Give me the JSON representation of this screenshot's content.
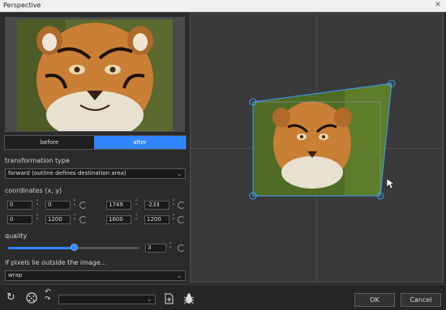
{
  "window": {
    "title": "Perspective",
    "close_glyph": "×"
  },
  "preview_toggle": {
    "before_label": "before",
    "after_label": "after",
    "selected": "after"
  },
  "transformation": {
    "label": "transformation type",
    "selected": "forward (outline defines destination area)"
  },
  "coordinates": {
    "label": "coordinates (x, y)",
    "rows": [
      [
        "0",
        "0",
        "1749",
        "-233"
      ],
      [
        "0",
        "1200",
        "1600",
        "1200"
      ]
    ]
  },
  "quality": {
    "label": "quality",
    "value": "3",
    "level_fraction": 0.5
  },
  "outside": {
    "label": "if pixels lie outside the image...",
    "selected": "wrap"
  },
  "buttons": {
    "ok_label": "OK",
    "cancel_label": "Cancel"
  },
  "icons": {
    "reset": "reset-icon",
    "random": "dice-icon",
    "undo_redo": "undo-redo-icon",
    "new_preset": "new-preset-icon",
    "bug": "bug-icon"
  },
  "colors": {
    "accent": "#2f86ff",
    "outline": "#3aa0ff"
  }
}
